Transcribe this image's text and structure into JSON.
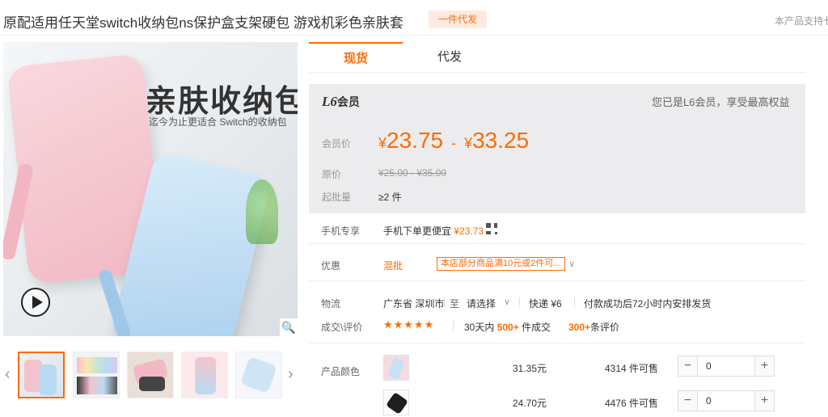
{
  "header": {
    "title": "原配适用任天堂switch收纳包ns保护盒支架硬包 游戏机彩色亲肤套",
    "badge": "一件代发",
    "right_text": "本产品支持七"
  },
  "gallery": {
    "main_title": "亲肤收纳包",
    "main_subtitle": "迄今为止更适合 Switch的收纳包",
    "play_icon": "play-icon",
    "zoom_icon": "magnifier-icon",
    "thumb_count": 5,
    "active_thumb": 0
  },
  "tabs": [
    {
      "label": "现货",
      "active": true
    },
    {
      "label": "代发",
      "active": false
    }
  ],
  "member": {
    "level": "L6",
    "level_suffix": "会员",
    "right_text": "您已是L6会员，享受最高权益"
  },
  "price": {
    "label": "会员价",
    "currency": "¥",
    "low": "23.75",
    "dash": "-",
    "high": "33.25",
    "orig_label": "原价",
    "orig_range": "¥25.00 - ¥35.00",
    "moq_label": "起批量",
    "moq_value": "≥2 件"
  },
  "mobile": {
    "label": "手机专享",
    "text": "手机下单更便宜",
    "price": "¥23.73"
  },
  "promo": {
    "label": "优惠",
    "type": "混批",
    "tag": "本店部分商品满10元或2件可..."
  },
  "logistics": {
    "label": "物流",
    "origin": "广东省 深圳市",
    "to": "至",
    "destination": "请选择",
    "shipping": "快递 ¥6",
    "delivery": "付款成功后72小时内安排发货"
  },
  "deals": {
    "label": "成交\\评价",
    "stars": "★★★★★",
    "days_text": "30天内",
    "deal_count": "500+",
    "deal_suffix": "件成交",
    "review_count": "300+",
    "review_suffix": "条评价"
  },
  "sku": {
    "label": "产品颜色",
    "rows": [
      {
        "price": "31.35元",
        "stock": "4314 件可售",
        "qty": "0",
        "color": "#f5cdd5"
      },
      {
        "price": "24.70元",
        "stock": "4476 件可售",
        "qty": "0",
        "color": "#1e1e1e"
      }
    ]
  },
  "colors": {
    "accent": "#ff6a00",
    "case_pink": "#f4c3cd",
    "case_blue": "#b9dbf3"
  }
}
